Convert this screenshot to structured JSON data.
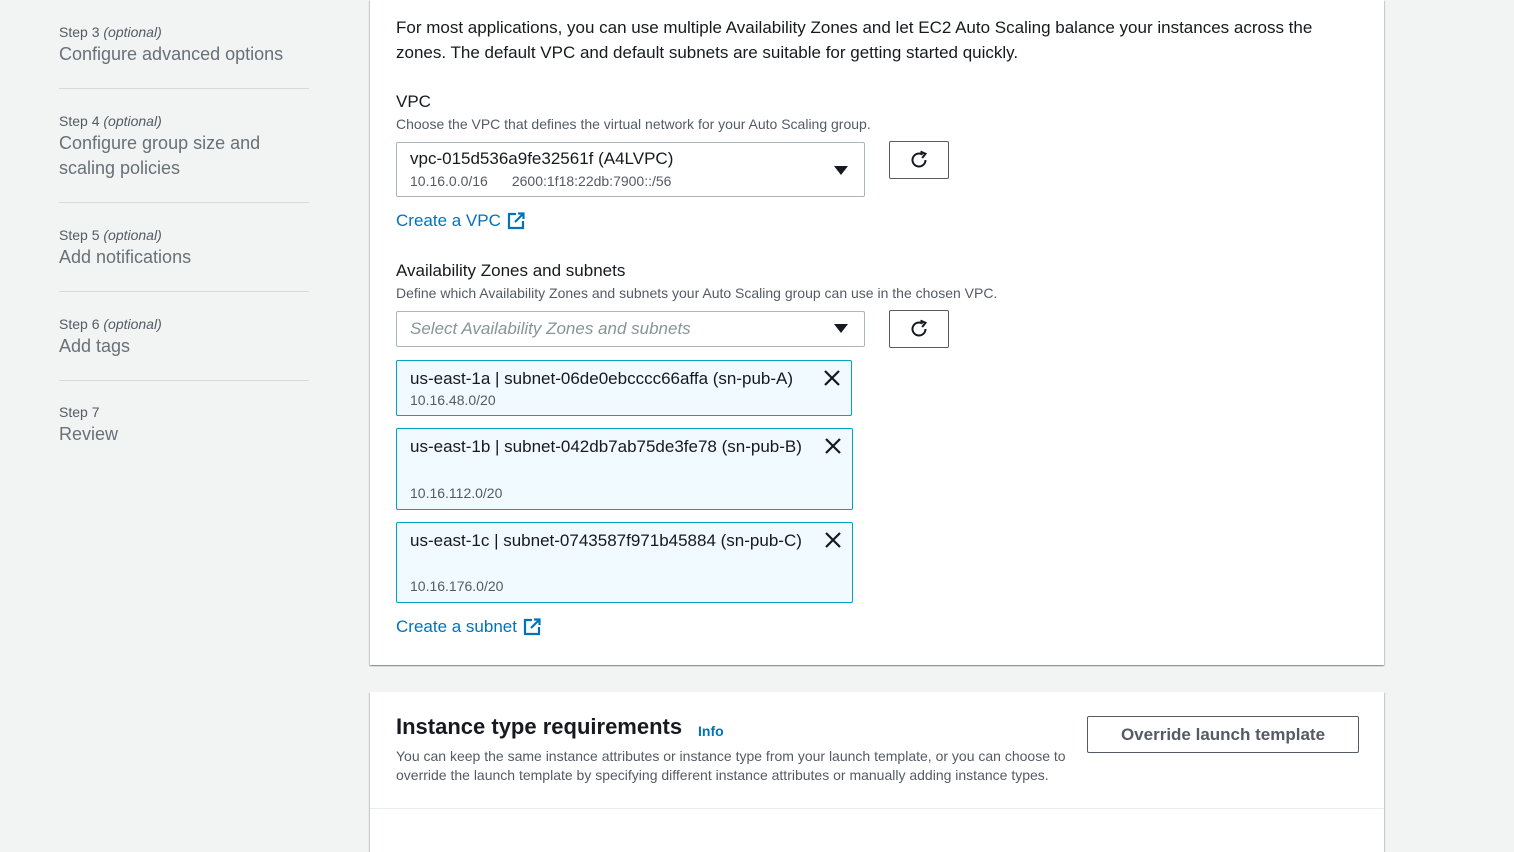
{
  "steps": [
    {
      "num": "Step 3",
      "optional": "(optional)",
      "title": "Configure advanced options"
    },
    {
      "num": "Step 4",
      "optional": "(optional)",
      "title": "Configure group size and scaling policies"
    },
    {
      "num": "Step 5",
      "optional": "(optional)",
      "title": "Add notifications"
    },
    {
      "num": "Step 6",
      "optional": "(optional)",
      "title": "Add tags"
    },
    {
      "num": "Step 7",
      "optional": "",
      "title": "Review"
    }
  ],
  "network": {
    "intro": "For most applications, you can use multiple Availability Zones and let EC2 Auto Scaling balance your instances across the zones. The default VPC and default subnets are suitable for getting started quickly.",
    "vpc": {
      "label": "VPC",
      "description": "Choose the VPC that defines the virtual network for your Auto Scaling group.",
      "selected": "vpc-015d536a9fe32561f (A4LVPC)",
      "ipv4": "10.16.0.0/16",
      "ipv6": "2600:1f18:22db:7900::/56",
      "create_link": "Create a VPC"
    },
    "subnets": {
      "label": "Availability Zones and subnets",
      "description": "Define which Availability Zones and subnets your Auto Scaling group can use in the chosen VPC.",
      "placeholder": "Select Availability Zones and subnets",
      "tokens": [
        {
          "title": "us-east-1a | subnet-06de0ebcccc66affa (sn-pub-A)",
          "cidr": "10.16.48.0/20"
        },
        {
          "title": "us-east-1b | subnet-042db7ab75de3fe78 (sn-pub-B)",
          "cidr": "10.16.112.0/20"
        },
        {
          "title": "us-east-1c | subnet-0743587f971b45884 (sn-pub-C)",
          "cidr": "10.16.176.0/20"
        }
      ],
      "create_link": "Create a subnet"
    }
  },
  "instance_type": {
    "header": "Instance type requirements",
    "info": "Info",
    "description": "You can keep the same instance attributes or instance type from your launch template, or you can choose to override the launch template by specifying different instance attributes or manually adding instance types.",
    "override_button": "Override launch template"
  },
  "colors": {
    "link": "#0073bb",
    "token_border": "#00a1c9",
    "token_bg": "#f1faff"
  }
}
